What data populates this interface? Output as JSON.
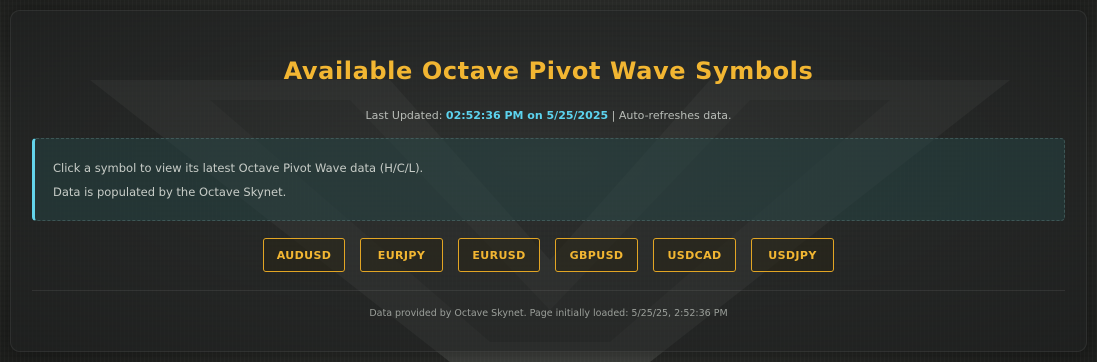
{
  "page": {
    "title": "Available Octave Pivot Wave Symbols",
    "last_updated_label": "Last Updated:",
    "last_updated_value": "02:52:36 PM on 5/25/2025",
    "auto_refresh_note": "| Auto-refreshes data."
  },
  "info": {
    "line1": "Click a symbol to view its latest Octave Pivot Wave data (H/C/L).",
    "line2": "Data is populated by the Octave Skynet."
  },
  "symbols": [
    "AUDUSD",
    "EURJPY",
    "EURUSD",
    "GBPUSD",
    "USDCAD",
    "USDJPY"
  ],
  "footer": {
    "text": "Data provided by Octave Skynet. Page initially loaded: 5/25/25, 2:52:36 PM"
  },
  "colors": {
    "accent_gold": "#f2b632",
    "accent_cyan": "#5cd3ee",
    "panel_bg": "#1e2120"
  }
}
